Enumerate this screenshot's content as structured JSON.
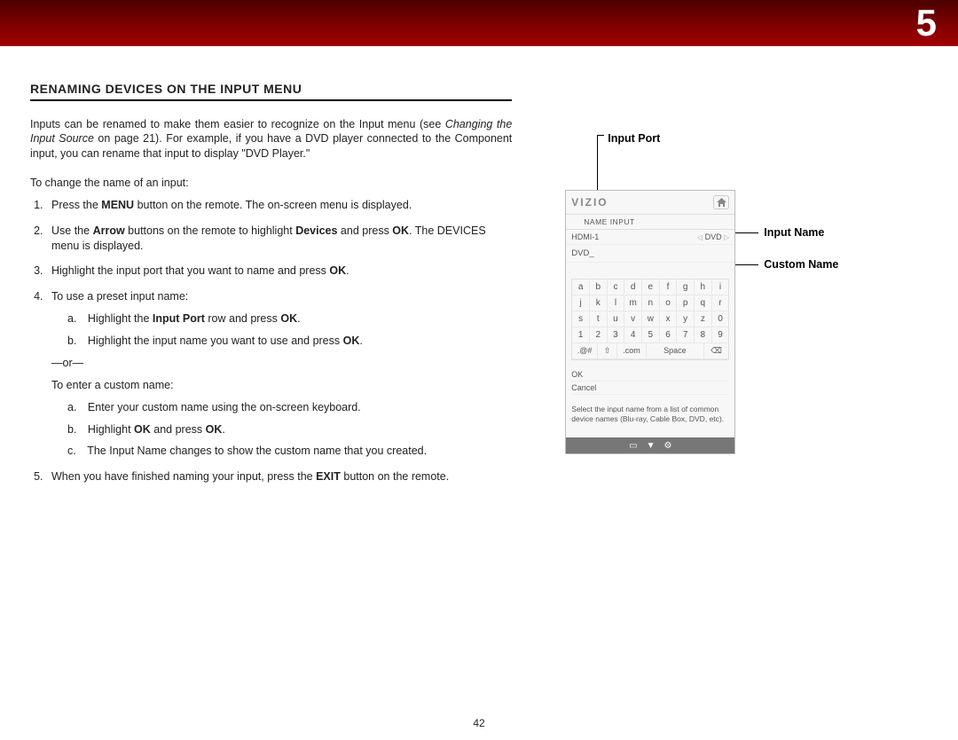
{
  "chapter_number": "5",
  "page_number": "42",
  "section_title": "RENAMING DEVICES ON THE INPUT MENU",
  "intro_html": "Inputs can be renamed to make them easier to recognize on the Input menu (see <em>Changing the Input Source</em> on page 21). For example, if you have a DVD player connected to the Component input, you can rename that input to display \"DVD Player.\"",
  "lead": "To change the name of an input:",
  "step1_html": "Press the <b>MENU</b> button on the remote. The on-screen menu is displayed.",
  "step2_html": "Use the <b>Arrow</b> buttons on the remote to highlight <b>Devices</b> and press <b>OK</b>. The DEVICES menu is displayed.",
  "step3_html": "Highlight the input port that you want to name and press <b>OK</b>.",
  "step4_lead": "To use a preset input name:",
  "step4a_html": "a. Highlight the <b>Input Port</b> row and press <b>OK</b>.",
  "step4b_html": "b. Highlight the input name you want to use and press <b>OK</b>.",
  "or": "—or—",
  "step4_custom_lead": "To enter a custom name:",
  "step4ca": "a. Enter your custom name using the on-screen keyboard.",
  "step4cb_html": "b. Highlight <b>OK</b> and press <b>OK</b>.",
  "step4cc": "c. The Input Name changes to show the custom name that you created.",
  "step5_html": "When you have finished naming your input, press the <b>EXIT</b> button on the remote.",
  "callouts": {
    "input_port": "Input Port",
    "input_name": "Input Name",
    "custom_name": "Custom Name"
  },
  "tv": {
    "logo": "VIZIO",
    "subtitle": "NAME INPUT",
    "port_label": "HDMI-1",
    "port_value": "DVD",
    "custom_value": "DVD_",
    "keys_r1": [
      "a",
      "b",
      "c",
      "d",
      "e",
      "f",
      "g",
      "h",
      "i"
    ],
    "keys_r2": [
      "j",
      "k",
      "l",
      "m",
      "n",
      "o",
      "p",
      "q",
      "r"
    ],
    "keys_r3": [
      "s",
      "t",
      "u",
      "v",
      "w",
      "x",
      "y",
      "z",
      "0"
    ],
    "keys_r4": [
      "1",
      "2",
      "3",
      "4",
      "5",
      "6",
      "7",
      "8",
      "9"
    ],
    "key_sym": ".@#",
    "key_shift": "⇧",
    "key_com": ".com",
    "key_space": "Space",
    "key_back": "⌫",
    "ok": "OK",
    "cancel": "Cancel",
    "help": "Select the input name from a list of common device names (Blu-ray, Cable Box, DVD, etc).",
    "footer_wide": "▭",
    "footer_down": "▼",
    "footer_gear": "⚙"
  }
}
